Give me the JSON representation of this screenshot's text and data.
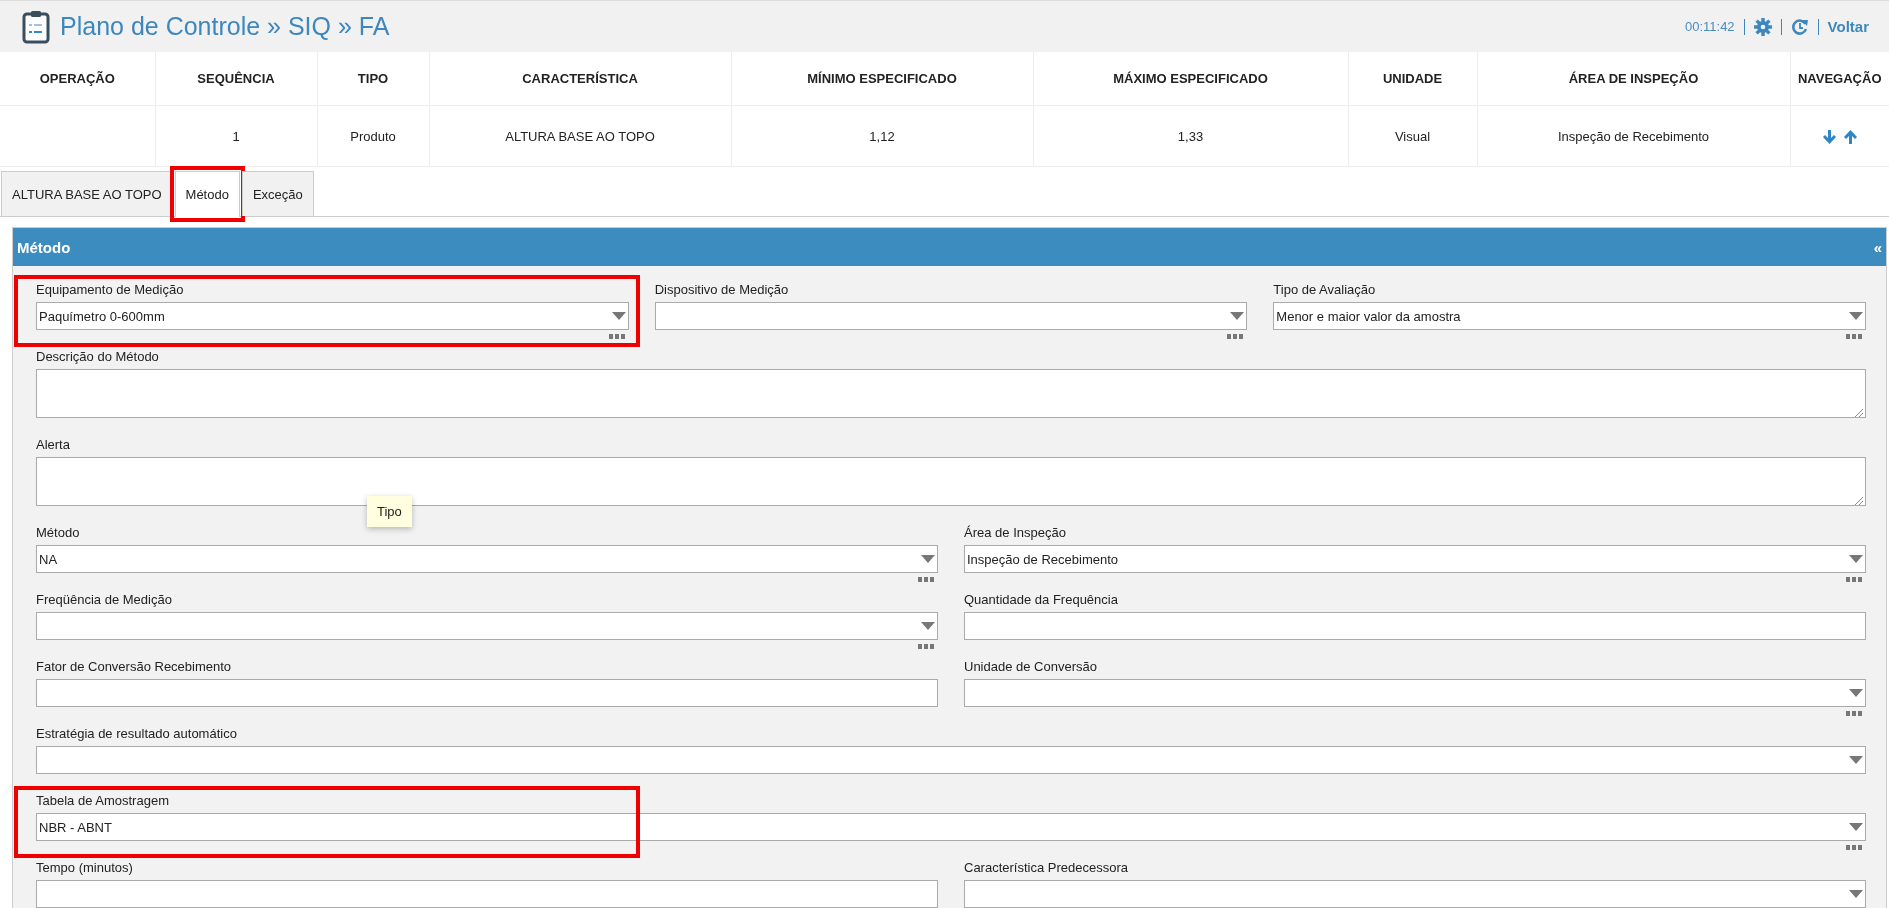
{
  "header": {
    "title": "Plano de Controle » SIQ » FA",
    "timer": "00:11:42",
    "back_link": "Voltar"
  },
  "table": {
    "columns": [
      "OPERAÇÃO",
      "SEQUÊNCIA",
      "TIPO",
      "CARACTERÍSTICA",
      "MÍNIMO ESPECIFICADO",
      "MÁXIMO ESPECIFICADO",
      "UNIDADE",
      "ÁREA DE INSPEÇÃO",
      "NAVEGAÇÃO"
    ],
    "rows": [
      {
        "cells": [
          {
            "kind": "empty"
          },
          {
            "kind": "text",
            "text": "1"
          },
          {
            "kind": "text",
            "text": "Produto"
          },
          {
            "kind": "text",
            "text": "ALTURA BASE AO TOPO"
          },
          {
            "kind": "text",
            "text": "1,12"
          },
          {
            "kind": "text",
            "text": "1,33"
          },
          {
            "kind": "text",
            "text": "Visual"
          },
          {
            "kind": "text",
            "text": "Inspeção de Recebimento"
          },
          {
            "kind": "navigation"
          }
        ]
      }
    ]
  },
  "tabs": [
    {
      "label": "ALTURA BASE AO TOPO",
      "selected": false,
      "highlighted": false
    },
    {
      "label": "Método",
      "selected": true,
      "highlighted": true
    },
    {
      "label": "Exceção",
      "selected": false,
      "highlighted": false
    }
  ],
  "section": {
    "title": "Método",
    "collapse": "«"
  },
  "form_rows": [
    [
      {
        "label": "Equipamento de Medição",
        "kind": "select",
        "value": "Paquímetro 0-600mm",
        "lookup": true,
        "highlighted": true
      },
      {
        "label": "Dispositivo de Medição",
        "kind": "select",
        "lookup": true,
        "highlighted": false
      },
      {
        "label": "Tipo de Avaliação",
        "kind": "select",
        "value": "Menor e maior valor da amostra",
        "lookup": true,
        "highlighted": false
      }
    ],
    [
      {
        "label": "Descrição do Método",
        "kind": "textarea",
        "lookup": false,
        "highlighted": false
      }
    ],
    [
      {
        "label": "Alerta",
        "kind": "textarea",
        "lookup": false,
        "highlighted": false
      }
    ],
    [
      {
        "label": "Método",
        "kind": "select",
        "value": "NA",
        "lookup": true,
        "highlighted": false
      },
      {
        "label": "Área de Inspeção",
        "kind": "select",
        "value": "Inspeção de Recebimento",
        "lookup": true,
        "highlighted": false
      }
    ],
    [
      {
        "label": "Freqüência de Medição",
        "kind": "select",
        "lookup": true,
        "highlighted": false
      },
      {
        "label": "Quantidade da Frequência",
        "kind": "input",
        "lookup": false,
        "highlighted": false
      }
    ],
    [
      {
        "label": "Fator de Conversão Recebimento",
        "kind": "input",
        "lookup": false,
        "highlighted": false
      },
      {
        "label": "Unidade de Conversão",
        "kind": "select",
        "lookup": true,
        "highlighted": false
      }
    ],
    [
      {
        "label": "Estratégia de resultado automático",
        "kind": "select",
        "lookup": false,
        "highlighted": false
      }
    ],
    [
      {
        "label": "Tabela de Amostragem",
        "kind": "select",
        "value": "NBR - ABNT",
        "lookup": true,
        "highlighted": true
      }
    ],
    [
      {
        "label": "Tempo (minutos)",
        "kind": "input",
        "lookup": false,
        "highlighted": false
      },
      {
        "label": "Característica Predecessora",
        "kind": "select",
        "lookup": false,
        "highlighted": false
      }
    ]
  ],
  "tooltip": {
    "text": "Tipo"
  }
}
